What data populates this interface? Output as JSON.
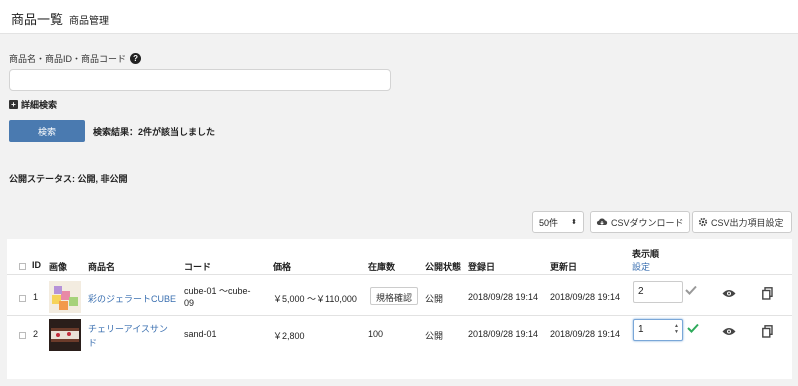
{
  "header": {
    "title": "商品一覧",
    "subtitle": "商品管理"
  },
  "search": {
    "label": "商品名・商品ID・商品コード",
    "input_value": "",
    "advanced_label": "詳細検索",
    "button_label": "検索",
    "result_text": "検索結果：2件が該当しました"
  },
  "status_text": "公開ステータス: 公開, 非公開",
  "toolbar": {
    "per_page": "50件",
    "csv_download": "CSVダウンロード",
    "csv_settings": "CSV出力項目設定"
  },
  "table": {
    "columns": {
      "id": "ID",
      "image": "画像",
      "name": "商品名",
      "code": "コード",
      "price": "価格",
      "stock": "在庫数",
      "status": "公開状態",
      "registered": "登録日",
      "updated": "更新日",
      "order": "表示順",
      "order_set": "設定"
    },
    "rows": [
      {
        "id": "1",
        "name": "彩のジェラートCUBE",
        "code_line1": "cube-01 ～cube-",
        "code_line2": "09",
        "price": "￥5,000 ～￥110,000",
        "stock": "規格確認",
        "status": "公開",
        "registered": "2018/09/28 19:14",
        "updated": "2018/09/28 19:14",
        "order": "2"
      },
      {
        "id": "2",
        "name_line1": "チェリーアイスサン",
        "name_line2": "ド",
        "code": "sand-01",
        "price": "￥2,800",
        "stock": "100",
        "status": "公開",
        "registered": "2018/09/28 19:14",
        "updated": "2018/09/28 19:14",
        "order": "1"
      }
    ]
  },
  "colors": {
    "primary": "#4a7ab0",
    "link": "#3a6fb0",
    "check_active": "#2eaa5b",
    "check_inactive": "#999999"
  }
}
